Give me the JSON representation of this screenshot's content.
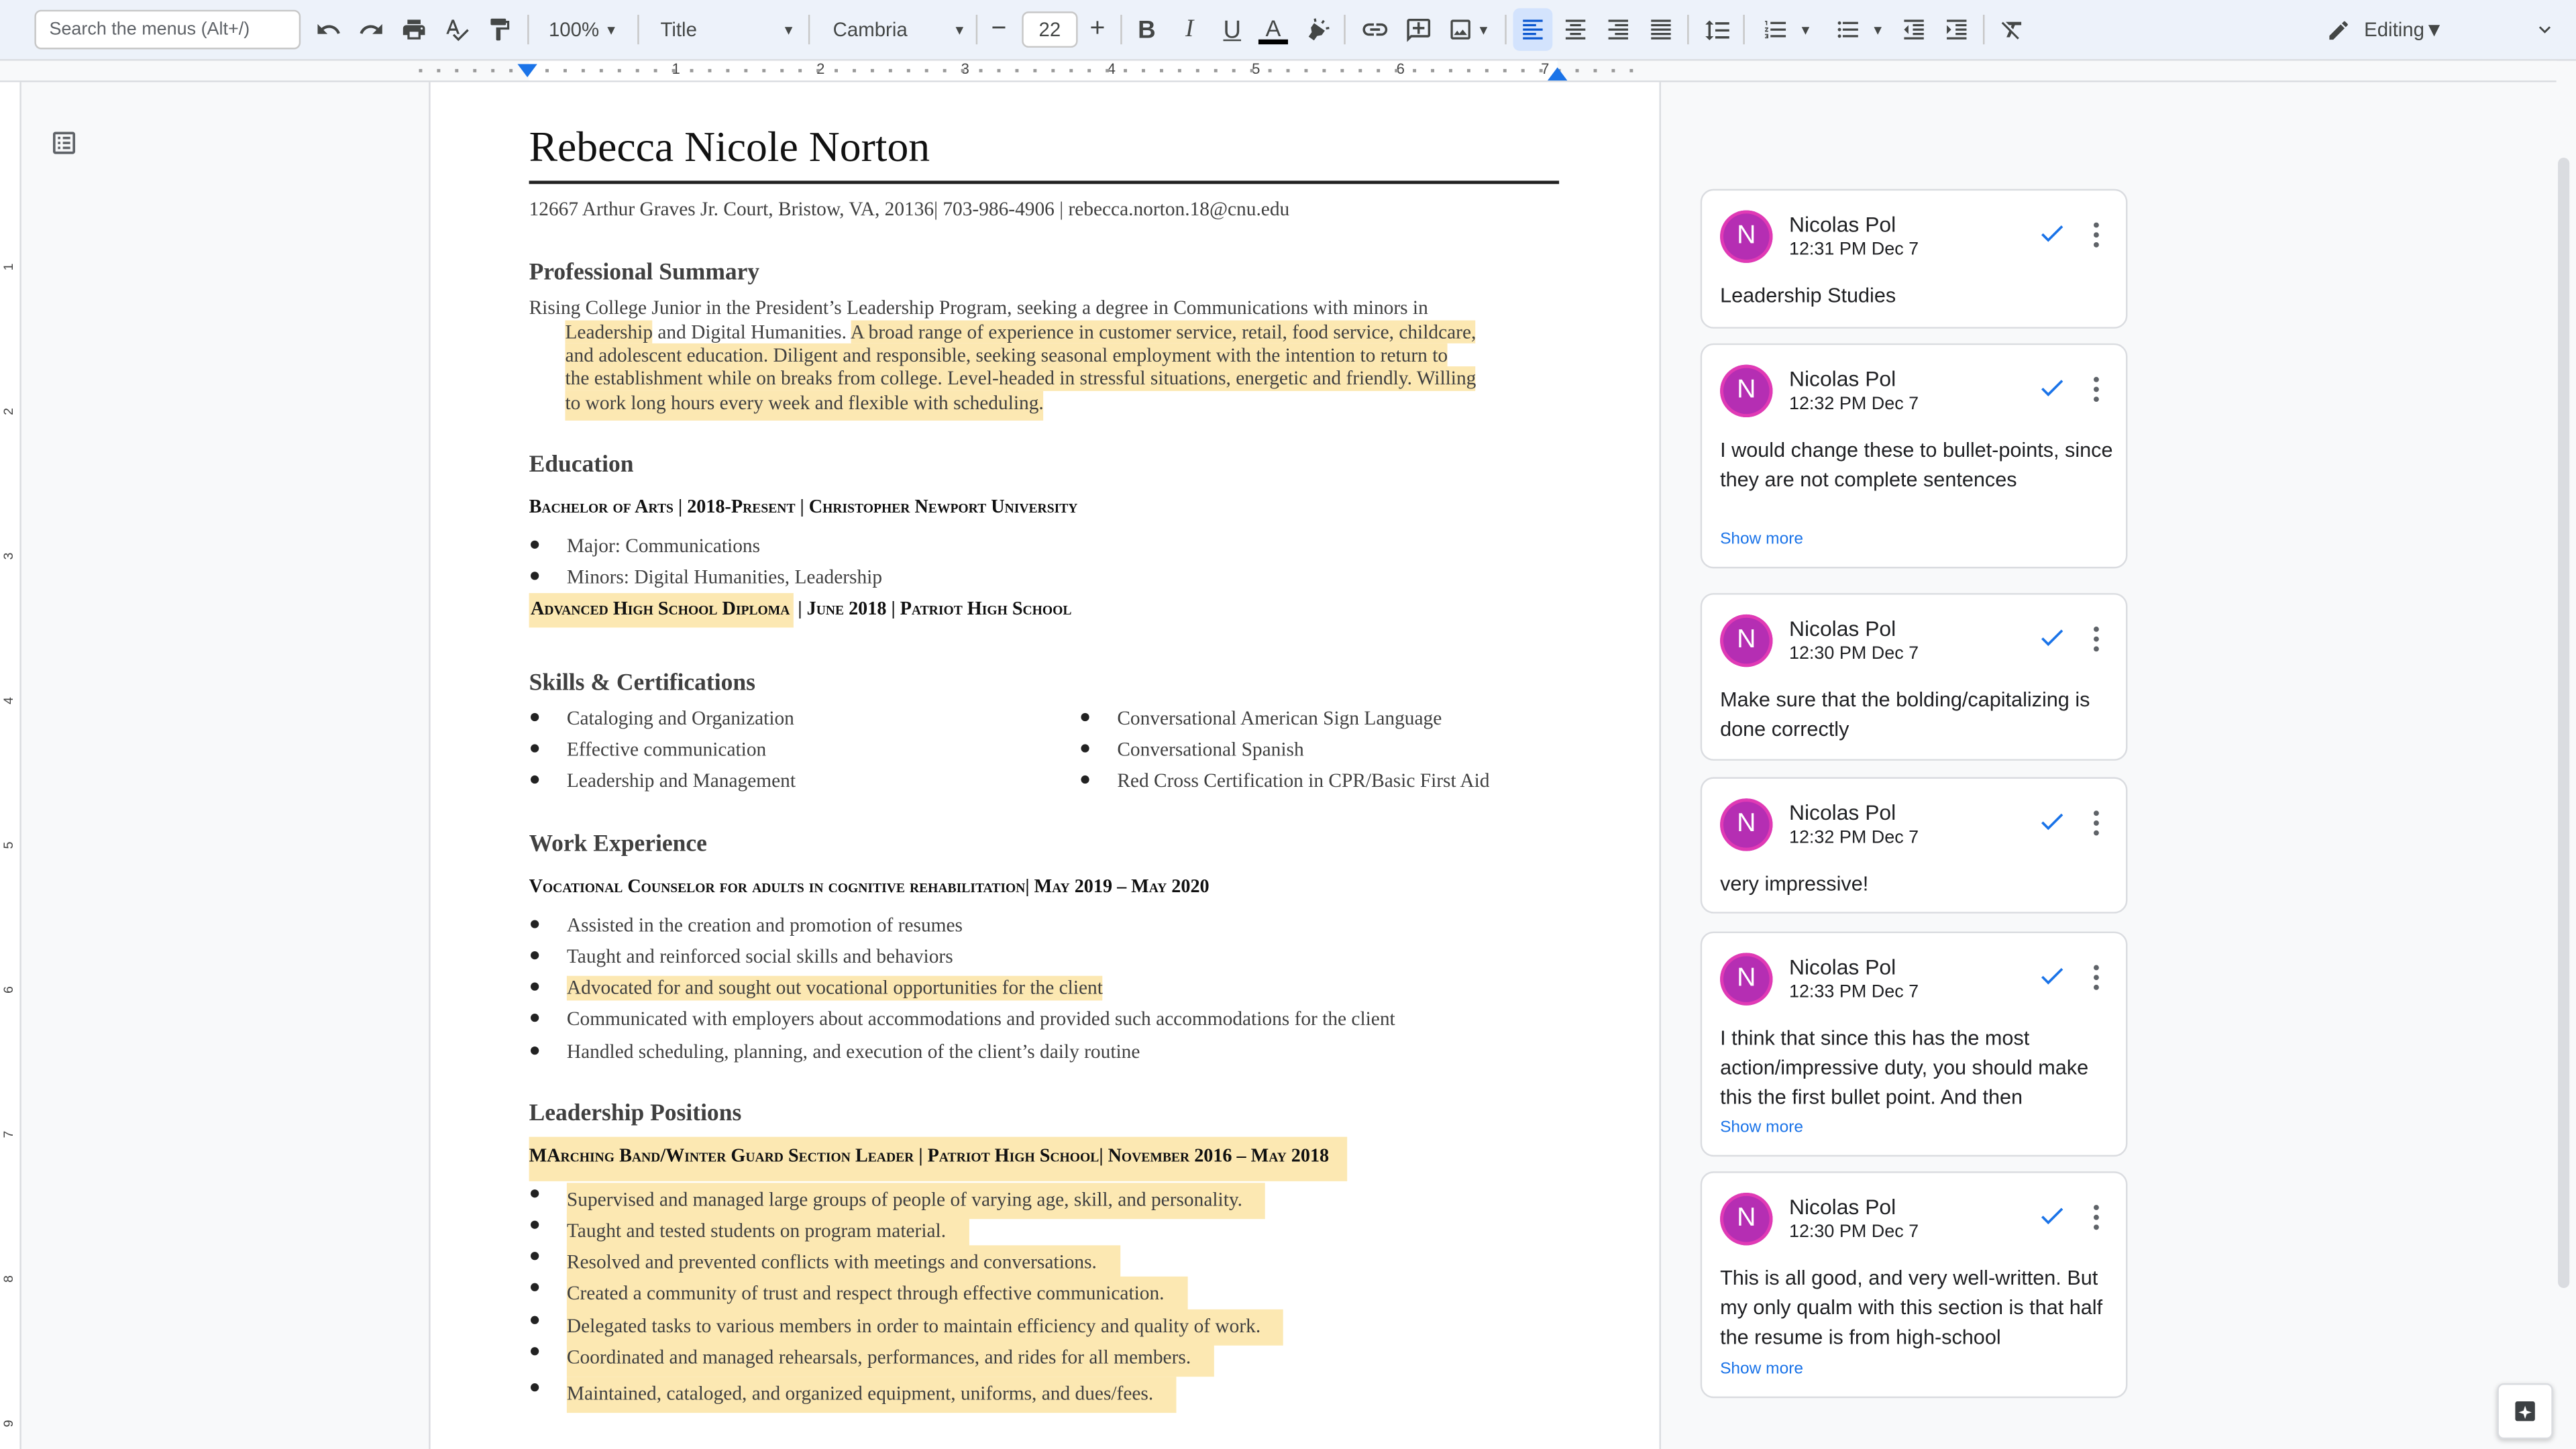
{
  "toolbar": {
    "search_placeholder": "Search the menus (Alt+/)",
    "zoom": "100%",
    "style": "Title",
    "font": "Cambria",
    "font_size": "22",
    "minus": "−",
    "plus": "+",
    "bold": "B",
    "italic": "I",
    "underline": "U",
    "text_color": "A",
    "mode": "Editing"
  },
  "ruler": {
    "h": [
      "1",
      "2",
      "3",
      "4",
      "5",
      "6",
      "7"
    ],
    "v": [
      "1",
      "2",
      "3",
      "4",
      "5",
      "6",
      "7",
      "8",
      "9"
    ]
  },
  "document": {
    "name": "Rebecca Nicole Norton",
    "contact": "12667 Arthur Graves Jr. Court, Bristow, VA, 20136| 703-986-4906 | rebecca.norton.18@cnu.edu",
    "summary_heading": "Professional Summary",
    "summary_lines": [
      "Rising College Junior in the President’s Leadership Program, seeking a degree in Communications with minors in",
      "Leadership",
      " and Digital Humanities. ",
      "A broad range of experience in customer service, retail, food service, childcare,",
      "and adolescent education. Diligent and responsible, seeking seasonal employment with the intention to return to",
      "the establishment while on breaks from college.  Level-headed in stressful situations, energetic and friendly. Willing",
      "to work long hours every week and flexible with scheduling."
    ],
    "education_heading": "Education",
    "ba_line": "Bachelor of Arts | 2018-Present | Christopher Newport University",
    "ba_bullets": [
      "Major: Communications",
      "Minors: Digital Humanities, Leadership"
    ],
    "hs_line_a": "Advanced High School Diploma",
    "hs_line_b": " | June 2018 | Patriot High School",
    "skills_heading": "Skills & Certifications",
    "skills_left": [
      "Cataloging and Organization",
      "Effective communication",
      "Leadership and Management"
    ],
    "skills_right": [
      "Conversational American Sign Language",
      "Conversational Spanish",
      "Red Cross Certification in CPR/Basic First Aid"
    ],
    "work_heading": "Work Experience",
    "work_line": "Vocational Counselor for adults in cognitive rehabilitation| May 2019 – May 2020",
    "work_bullets": [
      "Assisted in the creation and promotion of resumes",
      "Taught and reinforced social skills and behaviors",
      "Advocated for and sought out vocational opportunities for the client",
      "Communicated with employers about accommodations and provided such accommodations for the client",
      "Handled scheduling, planning, and execution of the client’s daily routine"
    ],
    "lead_heading": "Leadership Positions",
    "lead_line": "MArching Band/Winter Guard Section Leader | Patriot High School| November 2016 – May 2018",
    "lead_bullets": [
      "Supervised and managed large groups of people of varying age, skill, and personality.",
      "Taught and tested students on program material.",
      "Resolved and prevented conflicts with meetings and conversations.",
      "Created a community of trust and respect through effective communication.",
      "Delegated tasks to various members in order to maintain efficiency and quality of work.",
      "Coordinated and managed rehearsals, performances, and rides for all members.",
      "Maintained, cataloged, and organized equipment, uniforms, and dues/fees."
    ]
  },
  "comments": [
    {
      "avatar": "N",
      "author": "Nicolas Pol",
      "time": "12:31 PM Dec 7",
      "text": "Leadership Studies",
      "show_more": ""
    },
    {
      "avatar": "N",
      "author": "Nicolas Pol",
      "time": "12:32 PM Dec 7",
      "text": "I would change these to bullet-points, since they are not complete sentences",
      "show_more": "Show more"
    },
    {
      "avatar": "N",
      "author": "Nicolas Pol",
      "time": "12:30 PM Dec 7",
      "text": "Make sure that the bolding/capitalizing is done correctly",
      "show_more": ""
    },
    {
      "avatar": "N",
      "author": "Nicolas Pol",
      "time": "12:32 PM Dec 7",
      "text": "very impressive!",
      "show_more": ""
    },
    {
      "avatar": "N",
      "author": "Nicolas Pol",
      "time": "12:33 PM Dec 7",
      "text": "I think that since this has the most action/impressive duty, you should make this the first bullet point. And then",
      "show_more": "Show more"
    },
    {
      "avatar": "N",
      "author": "Nicolas Pol",
      "time": "12:30 PM Dec 7",
      "text": "This is all good, and very well-written. But my only qualm with this section is that half the resume is from high-school",
      "show_more": "Show more"
    }
  ],
  "colors": {
    "highlight": "#fce8b2",
    "avatar": "#b52eb3",
    "accent": "#1a73e8"
  },
  "icons": [
    "undo-icon",
    "redo-icon",
    "print-icon",
    "spellcheck-icon",
    "paint-format-icon",
    "highlighter-icon",
    "link-icon",
    "add-comment-icon",
    "image-icon",
    "align-left-icon",
    "align-center-icon",
    "align-right-icon",
    "justify-icon",
    "line-spacing-icon",
    "numbered-list-icon",
    "bulleted-list-icon",
    "decrease-indent-icon",
    "increase-indent-icon",
    "clear-formatting-icon",
    "pencil-icon",
    "outline-icon",
    "check-icon",
    "more-vert-icon",
    "explore-icon"
  ]
}
